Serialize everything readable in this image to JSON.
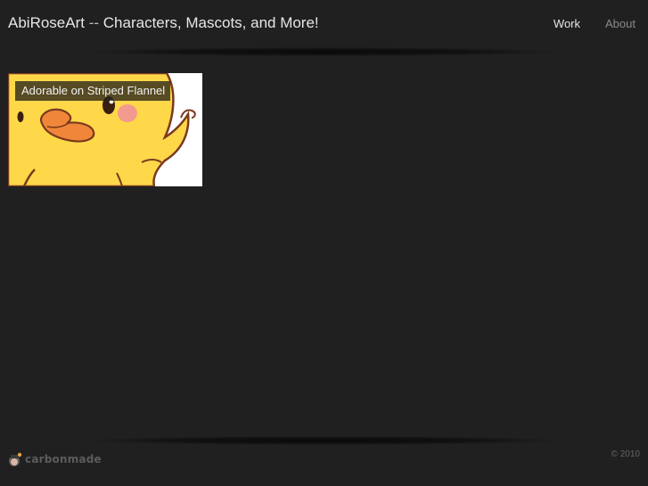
{
  "header": {
    "site_name": "AbiRoseArt",
    "separator": "--",
    "tagline": "Characters, Mascots, and More!",
    "nav": [
      {
        "label": "Work",
        "active": true
      },
      {
        "label": "About",
        "active": false
      }
    ]
  },
  "projects": [
    {
      "title": "Adorable on Striped Flannel",
      "thumbnail": "yellow-duck-illustration"
    }
  ],
  "footer": {
    "brand": "carbonmade",
    "copyright": "© 2010"
  },
  "colors": {
    "background": "#202020",
    "title_text": "#e6e6e6",
    "nav_inactive": "#8a8a8a",
    "duck_yellow": "#ffd84a",
    "duck_outline": "#7a3a1e"
  }
}
